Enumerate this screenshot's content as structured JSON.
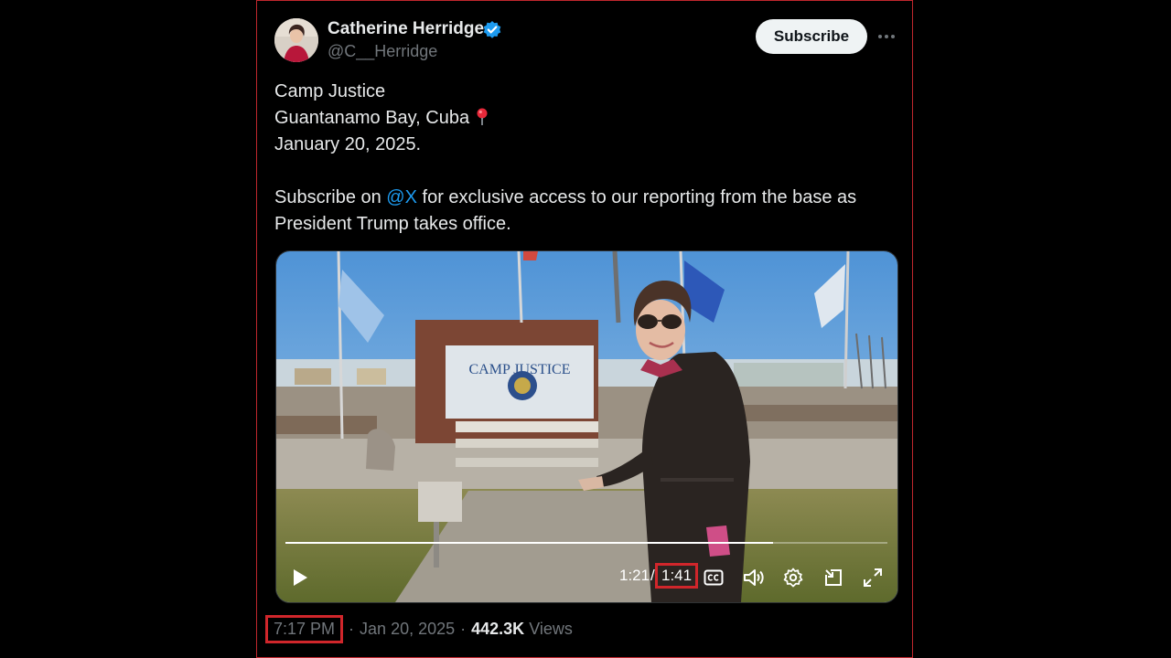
{
  "tweet": {
    "author_name": "Catherine Herridge",
    "handle": "@C__Herridge",
    "subscribe_label": "Subscribe",
    "more_icon": "more-horizontal-icon",
    "text_lines": {
      "line1": "Camp Justice",
      "line2": "Guantanamo Bay, Cuba",
      "line3": "January 20, 2025.",
      "line4_prefix": "Subscribe on ",
      "line4_mention": "@X",
      "line4_suffix": " for exclusive access to our reporting from the base as",
      "line5": "President Trump takes office."
    },
    "meta": {
      "time": "7:17 PM",
      "separator": "·",
      "date": "Jan 20, 2025",
      "views_count": "442.3K",
      "views_label": "Views"
    }
  },
  "video": {
    "sign_text": "CAMP JUSTICE",
    "current_time": "1:21",
    "time_separator": "/",
    "duration": "1:41",
    "progress_fraction": 0.81,
    "icons": [
      "play-icon",
      "captions-icon",
      "volume-icon",
      "settings-icon",
      "pip-icon",
      "fullscreen-icon"
    ]
  },
  "colors": {
    "accent": "#1d9bf0",
    "highlight_border": "#d0262b",
    "background": "#000000",
    "text_secondary": "#71767b"
  }
}
